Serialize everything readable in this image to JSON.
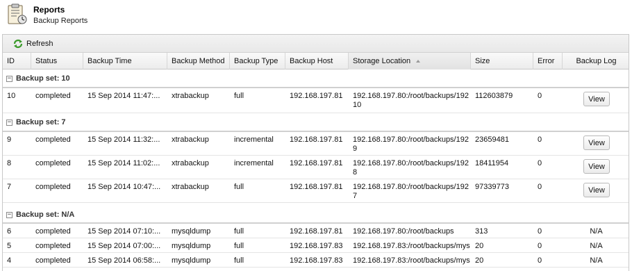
{
  "header": {
    "title": "Reports",
    "subtitle": "Backup Reports",
    "icon": "clipboard-report-icon"
  },
  "toolbar": {
    "refresh_label": "Refresh",
    "refresh_icon": "refresh-icon"
  },
  "columns": [
    "ID",
    "Status",
    "Backup Time",
    "Backup Method",
    "Backup Type",
    "Backup Host",
    "Storage Location",
    "Size",
    "Error",
    "Backup Log"
  ],
  "sorted_column": "Storage Location",
  "sort_direction": "ascending",
  "groups": [
    {
      "label": "Backup set: 10",
      "rows": [
        {
          "id": "10",
          "status": "completed",
          "time": "15 Sep 2014 11:47:...",
          "method": "xtrabackup",
          "type": "full",
          "host": "192.168.197.81",
          "location": "192.168.197.80:/root/backups/192",
          "location_cont": "10",
          "size": "112603879",
          "error": "0",
          "log": "View"
        }
      ]
    },
    {
      "label": "Backup set: 7",
      "rows": [
        {
          "id": "9",
          "status": "completed",
          "time": "15 Sep 2014 11:32:...",
          "method": "xtrabackup",
          "type": "incremental",
          "host": "192.168.197.81",
          "location": "192.168.197.80:/root/backups/192",
          "location_cont": "9",
          "size": "23659481",
          "error": "0",
          "log": "View"
        },
        {
          "id": "8",
          "status": "completed",
          "time": "15 Sep 2014 11:02:...",
          "method": "xtrabackup",
          "type": "incremental",
          "host": "192.168.197.81",
          "location": "192.168.197.80:/root/backups/192",
          "location_cont": "8",
          "size": "18411954",
          "error": "0",
          "log": "View"
        },
        {
          "id": "7",
          "status": "completed",
          "time": "15 Sep 2014 10:47:...",
          "method": "xtrabackup",
          "type": "full",
          "host": "192.168.197.81",
          "location": "192.168.197.80:/root/backups/192",
          "location_cont": "7",
          "size": "97339773",
          "error": "0",
          "log": "View"
        }
      ]
    },
    {
      "label": "Backup set: N/A",
      "rows": [
        {
          "id": "6",
          "status": "completed",
          "time": "15 Sep 2014 07:10:...",
          "method": "mysqldump",
          "type": "full",
          "host": "192.168.197.81",
          "location": "192.168.197.80:/root/backups",
          "location_cont": "",
          "size": "313",
          "error": "0",
          "log": "N/A"
        },
        {
          "id": "5",
          "status": "completed",
          "time": "15 Sep 2014 07:00:...",
          "method": "mysqldump",
          "type": "full",
          "host": "192.168.197.83",
          "location": "192.168.197.83:/root/backups/mys",
          "location_cont": "",
          "size": "20",
          "error": "0",
          "log": "N/A"
        },
        {
          "id": "4",
          "status": "completed",
          "time": "15 Sep 2014 06:58:...",
          "method": "mysqldump",
          "type": "full",
          "host": "192.168.197.83",
          "location": "192.168.197.83:/root/backups/mys",
          "location_cont": "",
          "size": "20",
          "error": "0",
          "log": "N/A"
        }
      ]
    }
  ]
}
